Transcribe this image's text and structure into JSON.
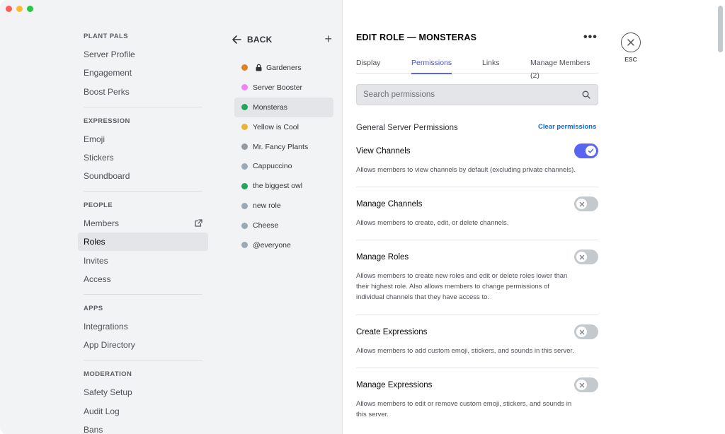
{
  "sidebar": {
    "sections": [
      {
        "title": "PLANT PALS",
        "items": [
          "Server Profile",
          "Engagement",
          "Boost Perks"
        ]
      },
      {
        "title": "EXPRESSION",
        "items": [
          "Emoji",
          "Stickers",
          "Soundboard"
        ]
      },
      {
        "title": "PEOPLE",
        "items": [
          "Members",
          "Roles",
          "Invites",
          "Access"
        ]
      },
      {
        "title": "APPS",
        "items": [
          "Integrations",
          "App Directory"
        ]
      },
      {
        "title": "MODERATION",
        "items": [
          "Safety Setup",
          "Audit Log",
          "Bans"
        ]
      }
    ],
    "active_item": "Roles"
  },
  "roles_panel": {
    "back_label": "BACK",
    "add_icon": "plus-icon",
    "roles": [
      {
        "name": "Gardeners",
        "color": "#e67e22",
        "locked": true
      },
      {
        "name": "Server Booster",
        "color": "#f47fff",
        "locked": false
      },
      {
        "name": "Monsteras",
        "color": "#23a55a",
        "locked": false,
        "active": true
      },
      {
        "name": "Yellow is Cool",
        "color": "#f0b232",
        "locked": false
      },
      {
        "name": "Mr. Fancy Plants",
        "color": "#949ba4",
        "locked": false
      },
      {
        "name": "Cappuccino",
        "color": "#99aab5",
        "locked": false
      },
      {
        "name": "the biggest owl",
        "color": "#23a55a",
        "locked": false
      },
      {
        "name": "new role",
        "color": "#99aab5",
        "locked": false
      },
      {
        "name": "Cheese",
        "color": "#99aab5",
        "locked": false
      },
      {
        "name": "@everyone",
        "color": "#99aab5",
        "locked": false
      }
    ]
  },
  "main": {
    "header": "EDIT ROLE — MONSTERAS",
    "more_label": "•••",
    "tabs": [
      "Display",
      "Permissions",
      "Links",
      "Manage Members (2)"
    ],
    "active_tab": "Permissions",
    "search": {
      "placeholder": "Search permissions",
      "value": ""
    },
    "group_title": "General Server Permissions",
    "clear_label": "Clear permissions",
    "permissions": [
      {
        "title": "View Channels",
        "desc": [
          "Allows members to view channels by default (excluding private channels)."
        ],
        "enabled": true
      },
      {
        "title": "Manage Channels",
        "desc": [
          "Allows members to create, edit, or delete channels."
        ],
        "enabled": false
      },
      {
        "title": "Manage Roles",
        "desc": [
          "Allows members to create new roles and edit or delete roles lower than",
          "their highest role. Also allows members to change permissions of",
          "individual channels that they have access to."
        ],
        "enabled": false
      },
      {
        "title": "Create Expressions",
        "desc": [
          "Allows members to add custom emoji, stickers, and sounds in this server."
        ],
        "enabled": false
      },
      {
        "title": "Manage Expressions",
        "desc": [
          "Allows members to edit or remove custom emoji, stickers, and sounds in",
          "this server."
        ],
        "enabled": false
      }
    ]
  },
  "close": {
    "label": "ESC"
  },
  "colors": {
    "accent": "#5865f2",
    "link": "#006ce7",
    "toggle_off": "#c4c9ce"
  }
}
